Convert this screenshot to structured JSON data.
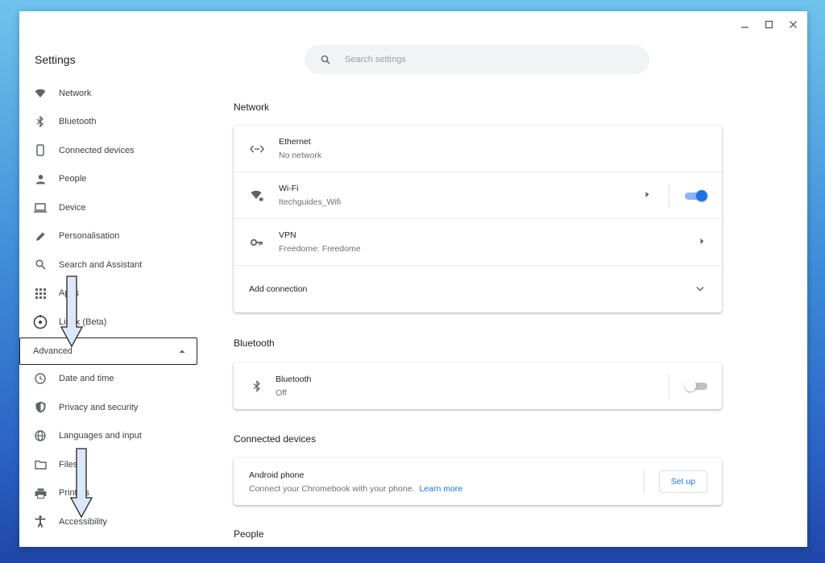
{
  "window": {
    "controls": [
      "minimize",
      "maximize",
      "close"
    ]
  },
  "app": {
    "title": "Settings"
  },
  "search": {
    "placeholder": "Search settings",
    "value": ""
  },
  "sidebar": {
    "items": [
      {
        "label": "Network",
        "icon": "wifi-icon"
      },
      {
        "label": "Bluetooth",
        "icon": "bluetooth-icon"
      },
      {
        "label": "Connected devices",
        "icon": "phone-icon"
      },
      {
        "label": "People",
        "icon": "person-icon"
      },
      {
        "label": "Device",
        "icon": "laptop-icon"
      },
      {
        "label": "Personalisation",
        "icon": "pen-icon"
      },
      {
        "label": "Search and Assistant",
        "icon": "search-icon"
      },
      {
        "label": "Apps",
        "icon": "apps-grid-icon"
      },
      {
        "label": "Linux (Beta)",
        "icon": "linux-icon"
      }
    ],
    "advanced": {
      "label": "Advanced",
      "expanded": true
    },
    "advanced_items": [
      {
        "label": "Date and time",
        "icon": "clock-icon"
      },
      {
        "label": "Privacy and security",
        "icon": "shield-icon"
      },
      {
        "label": "Languages and input",
        "icon": "globe-icon"
      },
      {
        "label": "Files",
        "icon": "folder-icon"
      },
      {
        "label": "Printers",
        "icon": "printer-icon"
      },
      {
        "label": "Accessibility",
        "icon": "accessibility-icon"
      }
    ]
  },
  "network": {
    "title": "Network",
    "ethernet": {
      "name": "Ethernet",
      "status": "No network"
    },
    "wifi": {
      "name": "Wi-Fi",
      "status": "Itechguides_Wifi",
      "enabled": true
    },
    "vpn": {
      "name": "VPN",
      "status": "Freedome: Freedome"
    },
    "add_connection": "Add connection"
  },
  "bluetooth": {
    "title": "Bluetooth",
    "name": "Bluetooth",
    "status": "Off",
    "enabled": false
  },
  "connected_devices": {
    "title": "Connected devices",
    "name": "Android phone",
    "description": "Connect your Chromebook with your phone.",
    "learn_more": "Learn more",
    "setup_label": "Set up"
  },
  "people": {
    "title": "People"
  },
  "colors": {
    "accent": "#1a73e8",
    "toggle_track_on": "#8ab4f8",
    "toggle_off": "#bdc1c6"
  }
}
